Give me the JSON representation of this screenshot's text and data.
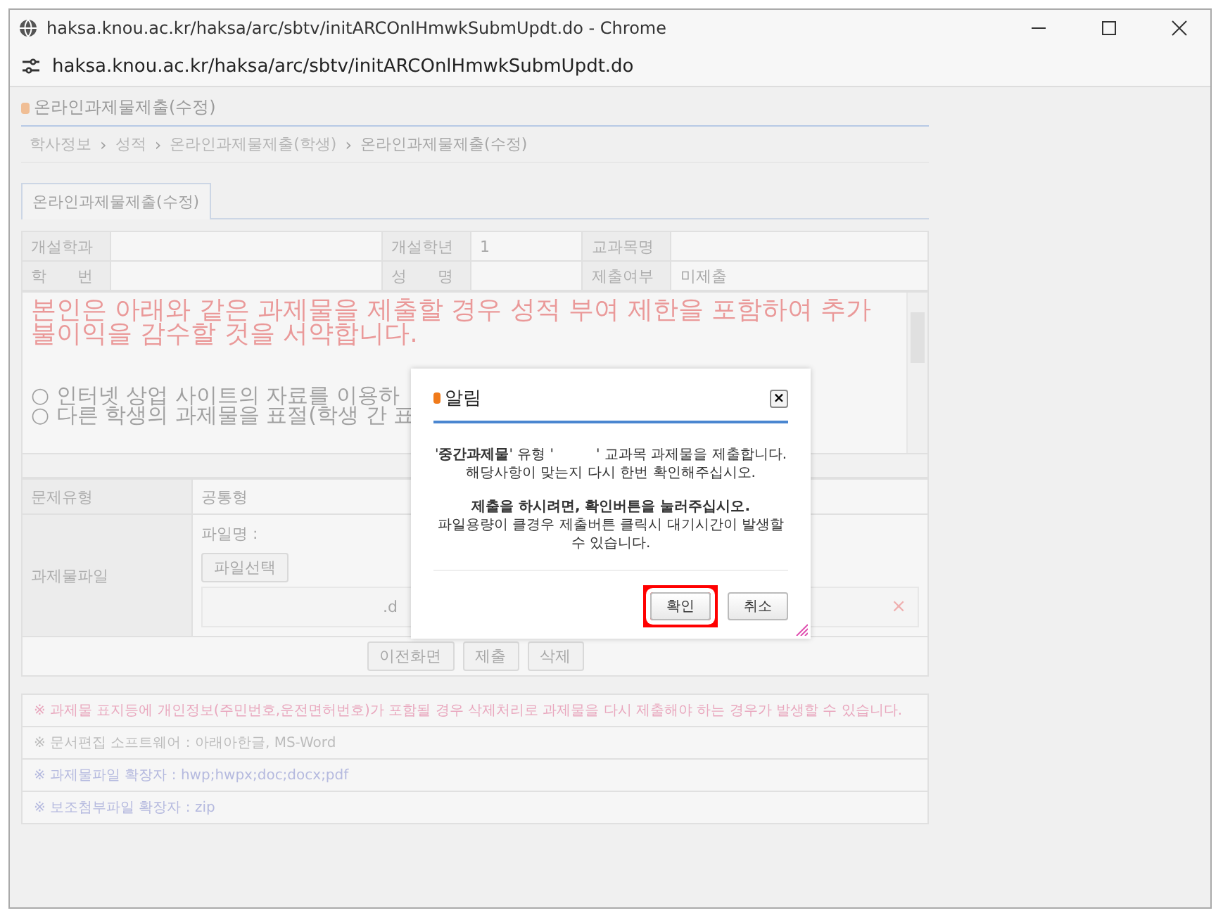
{
  "window": {
    "title": "haksa.knou.ac.kr/haksa/arc/sbtv/initARCOnlHmwkSubmUpdt.do - Chrome",
    "url": "haksa.knou.ac.kr/haksa/arc/sbtv/initARCOnlHmwkSubmUpdt.do"
  },
  "page": {
    "title": "온라인과제물제출(수정)",
    "breadcrumb": [
      "학사정보",
      "성적",
      "온라인과제물제출(학생)",
      "온라인과제물제출(수정)"
    ],
    "breadcrumb_separator": "›",
    "tabs": [
      {
        "label": "온라인과제물제출(수정)",
        "selected": true
      }
    ],
    "info_rows": [
      [
        {
          "label": "개설학과"
        },
        {
          "label": "개설학년",
          "value": "1"
        },
        {
          "label": "교과목명"
        }
      ],
      [
        {
          "label": "학　　번"
        },
        {
          "label": "성　　명"
        },
        {
          "label": "제출여부",
          "value": "미제출"
        }
      ]
    ],
    "pledge": {
      "heading": "본인은 아래와 같은 과제물을 제출할 경우 성적 부여 제한을 포함하여 추가 불이익을 감수할 것을 서약합니다.",
      "items": [
        "○ 인터넷 상업 사이트의 자료를 이용하",
        "○ 다른 학생의 과제물을 표절(학생 간 표"
      ]
    },
    "question_type": {
      "label": "문제유형",
      "value": "공통형"
    },
    "file": {
      "label": "과제물파일",
      "filename_label": "파일명 :",
      "choose_button": "파일선택",
      "file_suffix": ".d",
      "remove_icon": "×"
    },
    "actions": [
      "이전화면",
      "제출",
      "삭제"
    ],
    "notes": [
      {
        "kind": "warning",
        "text": "※ 과제물 표지등에 개인정보(주민번호,운전면허번호)가 포함될 경우 삭제처리로 과제물을 다시 제출해야 하는 경우가 발생할 수 있습니다."
      },
      {
        "kind": "info",
        "text": "※ 문서편집 소프트웨어 : 아래아한글, MS-Word"
      },
      {
        "kind": "link",
        "text": "※ 과제물파일 확장자 : hwp;hwpx;doc;docx;pdf"
      },
      {
        "kind": "link",
        "text": "※ 보조첨부파일 확장자 : zip"
      }
    ]
  },
  "dialog": {
    "title": "알림",
    "close": "×",
    "message": "'**중간과제물**' 유형 '　　　' 교과목 과제물을 제출합니다. 해당사항이 맞는지 다시 한번 확인해주십시오.",
    "instruction": "제출을 하시려면, 확인버튼을 눌러주십시오.",
    "note": "파일용량이 클경우 제출버튼 클릭시 대기시간이 발생할 수 있습니다.",
    "buttons": [
      {
        "label": "확인",
        "highlighted": true
      },
      {
        "label": "취소",
        "highlighted": false
      }
    ]
  }
}
